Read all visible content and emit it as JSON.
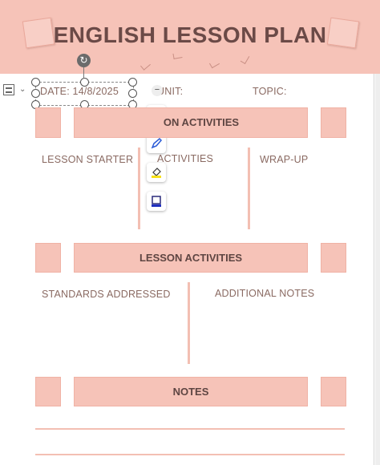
{
  "title": "ENGLISH LESSON PLAN",
  "fields": {
    "date": "DATE: 14/8/2025",
    "unit": "UNIT:",
    "topic": "TOPIC:"
  },
  "sections": {
    "top_bar": "LESSON ACTIVITIES",
    "top_bar_visible": "ON ACTIVITIES",
    "col_starter": "LESSON STARTER",
    "col_activities": "ACTIVITIES",
    "col_wrapup": "WRAP-UP",
    "middle_bar": "LESSON ACTIVITIES",
    "col_standards": "STANDARDS ADDRESSED",
    "col_notes": "ADDITIONAL NOTES",
    "bottom_bar": "NOTES"
  },
  "toolbar": {
    "rotate_icon": "rotate-icon",
    "layout_icon": "layout-options-icon",
    "tools": [
      "text-wrap-icon",
      "pen-icon",
      "fill-color-icon",
      "border-color-icon"
    ]
  },
  "colors": {
    "accent": "#f6c3b8",
    "title": "#6b4a47",
    "text": "#8a6a62"
  }
}
